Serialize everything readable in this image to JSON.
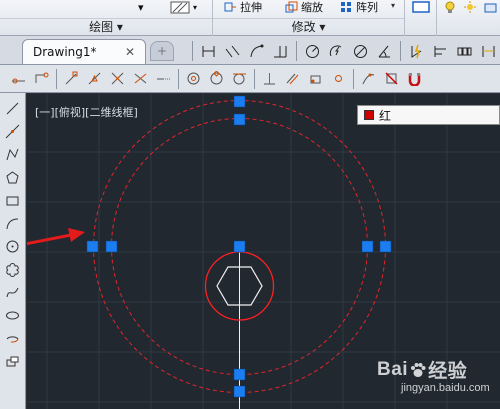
{
  "ribbon": {
    "panels": [
      {
        "label": "绘图 ▾"
      },
      {
        "label": "修改 ▾"
      }
    ],
    "buttons": [
      {
        "label": "拉伸"
      },
      {
        "label": "缩放"
      },
      {
        "label": "阵列"
      }
    ]
  },
  "tabs": {
    "doc": {
      "label": "Drawing1*",
      "close": "✕"
    },
    "new_tab": "+"
  },
  "toolbars": {
    "dimension": [
      "linear-dim-icon",
      "aligned-dim-icon",
      "arc-length-icon",
      "ordinate-icon",
      "radius-dim-icon",
      "jogged-icon",
      "diameter-icon",
      "angular-icon",
      "quick-dim-icon",
      "baseline-icon",
      "continue-icon",
      "dim-space-icon",
      "dim-break-icon"
    ],
    "snaps": [
      "temp-track-icon",
      "from-icon",
      "endpoint-icon",
      "midpoint-icon",
      "intersection-icon",
      "apparent-int-icon",
      "extension-icon",
      "center-icon",
      "quadrant-icon",
      "tangent-icon",
      "perpendicular-icon",
      "parallel-icon",
      "insert-icon",
      "node-icon",
      "nearest-icon",
      "none-icon",
      "osnap-settings-icon"
    ],
    "draw": [
      "line-icon",
      "xline-icon",
      "pline-icon",
      "polygon-icon",
      "rectangle-icon",
      "arc-icon",
      "circle-icon",
      "revcloud-icon",
      "spline-icon",
      "ellipse-icon",
      "ellipse-arc-icon",
      "insert-block-icon"
    ]
  },
  "viewport": {
    "label": "[一][俯视][二维线框]"
  },
  "layer": {
    "name": "红",
    "color": "#d00000"
  },
  "watermark": {
    "logo_left": "Bai",
    "logo_right": "经验",
    "url": "jingyan.baidu.com"
  },
  "colors": {
    "canvas": "#212830",
    "grid": "#2f3845",
    "dashed_circles": "#e0262b",
    "grip": "#1a7ef0",
    "arrow": "#e31b1b"
  }
}
